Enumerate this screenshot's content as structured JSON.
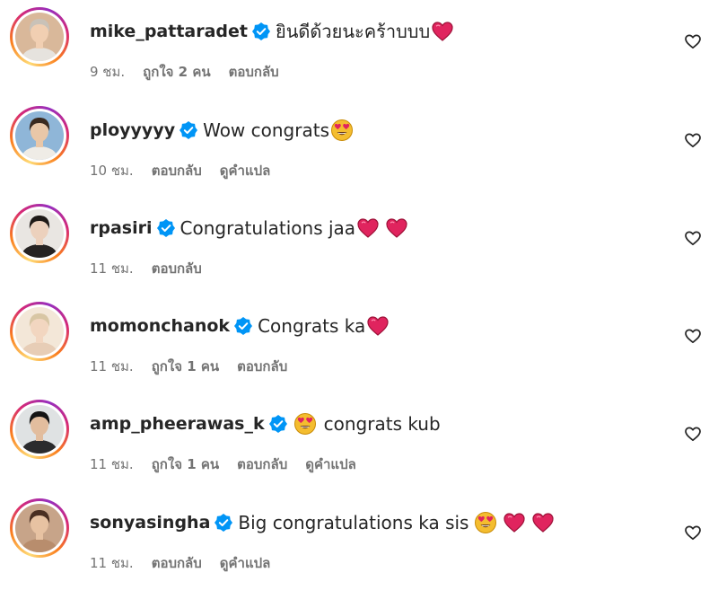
{
  "comments": [
    {
      "username": "mike_pattaradet",
      "text": "ยินดีด้วยนะคร้าบบบ",
      "emojis": [
        "heart"
      ],
      "time": "9 ชม.",
      "likes": "ถูกใจ 2 คน",
      "reply": "ตอบกลับ",
      "avatar": {
        "bg": "#d9b89a",
        "skin": "#f1cfb2",
        "hair": "#c9c2b8",
        "shirt": "#e6e3de"
      }
    },
    {
      "username": "ployyyyy",
      "text": "Wow congrats",
      "emojis": [
        "heart-eyes"
      ],
      "time": "10 ชม.",
      "reply": "ตอบกลับ",
      "translate": "ดูคำแปล",
      "avatar": {
        "bg": "#8fb6d8",
        "skin": "#e9c7a8",
        "hair": "#3a2a20",
        "shirt": "#efece6"
      }
    },
    {
      "username": "rpasiri",
      "text": "Congratulations jaa",
      "emojis": [
        "heart",
        "heart"
      ],
      "time": "11 ชม.",
      "reply": "ตอบกลับ",
      "avatar": {
        "bg": "#e9e6e2",
        "skin": "#ecd1bd",
        "hair": "#1f1a17",
        "shirt": "#262322"
      }
    },
    {
      "username": "momonchanok",
      "text": "Congrats ka",
      "emojis": [
        "heart"
      ],
      "time": "11 ชม.",
      "likes": "ถูกใจ 1 คน",
      "reply": "ตอบกลับ",
      "avatar": {
        "bg": "#f3e7d8",
        "skin": "#f2d6c0",
        "hair": "#d8c6a4",
        "shirt": "#e7cdb6"
      }
    },
    {
      "username": "amp_pheerawas_k",
      "text": "congrats kub",
      "emojis_before": [
        "heart-eyes"
      ],
      "emojis": [],
      "time": "11 ชม.",
      "likes": "ถูกใจ 1 คน",
      "reply": "ตอบกลับ",
      "translate": "ดูคำแปล",
      "avatar": {
        "bg": "#dfe2e3",
        "skin": "#e2bd9e",
        "hair": "#141414",
        "shirt": "#2b2b2d"
      }
    },
    {
      "username": "sonyasingha",
      "text": "Big congratulations ka sis",
      "emojis": [
        "heart-eyes",
        "heart",
        "heart"
      ],
      "time": "11 ชม.",
      "reply": "ตอบกลับ",
      "translate": "ดูคำแปล",
      "avatar": {
        "bg": "#c7a489",
        "skin": "#e7c2a2",
        "hair": "#4a2f22",
        "shirt": "#b88d6d"
      }
    }
  ],
  "colors": {
    "verified": "#0095f6",
    "meta": "#737373",
    "heart": "#e0245e",
    "text": "#262626"
  }
}
